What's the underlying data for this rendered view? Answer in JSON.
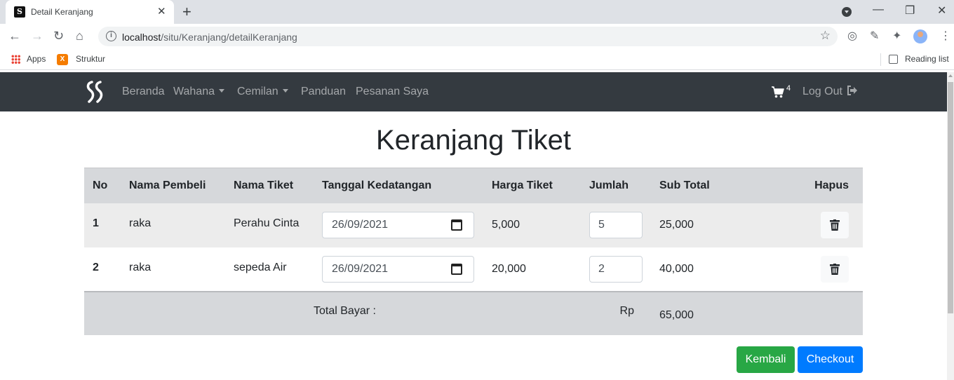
{
  "browser": {
    "tab_title": "Detail Keranjang",
    "url_host": "localhost",
    "url_path": "/situ/Keranjang/detailKeranjang",
    "bookmarks": [
      "Apps",
      "Struktur"
    ],
    "reading_list": "Reading list"
  },
  "navbar": {
    "links": [
      "Beranda",
      "Wahana",
      "Cemilan",
      "Panduan",
      "Pesanan Saya"
    ],
    "cart_count": "4",
    "logout": "Log Out"
  },
  "page": {
    "title": "Keranjang Tiket"
  },
  "table": {
    "headers": [
      "No",
      "Nama Pembeli",
      "Nama Tiket",
      "Tanggal Kedatangan",
      "Harga Tiket",
      "Jumlah",
      "Sub Total",
      "Hapus"
    ],
    "rows": [
      {
        "no": "1",
        "buyer": "raka",
        "ticket": "Perahu Cinta",
        "date": "26/09/2021",
        "price": "5,000",
        "qty": "5",
        "subtotal": "25,000"
      },
      {
        "no": "2",
        "buyer": "raka",
        "ticket": "sepeda Air",
        "date": "26/09/2021",
        "price": "20,000",
        "qty": "2",
        "subtotal": "40,000"
      }
    ],
    "total_label": "Total Bayar :",
    "currency": "Rp",
    "total_value": "65,000"
  },
  "buttons": {
    "back": "Kembali",
    "checkout": "Checkout"
  }
}
